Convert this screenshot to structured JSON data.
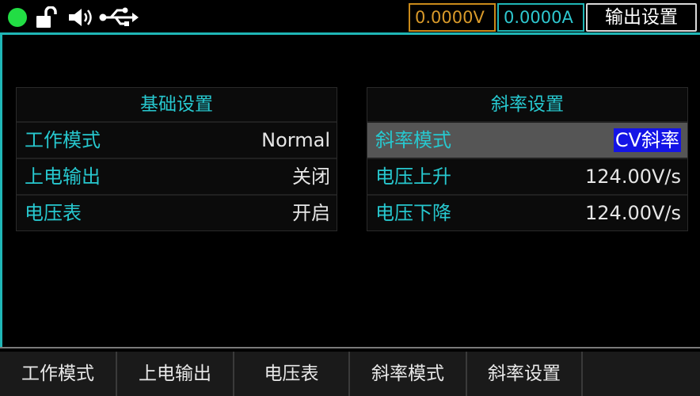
{
  "status": {
    "indicator_color": "#22dd44",
    "icons": [
      "lock-open-icon",
      "speaker-icon",
      "usb-icon"
    ],
    "voltage_readout": "0.0000V",
    "current_readout": "0.0000A",
    "page_title": "输出设置"
  },
  "panels": {
    "basic": {
      "title": "基础设置",
      "rows": [
        {
          "label": "工作模式",
          "value": "Normal"
        },
        {
          "label": "上电输出",
          "value": "关闭"
        },
        {
          "label": "电压表",
          "value": "开启"
        }
      ]
    },
    "slope": {
      "title": "斜率设置",
      "rows": [
        {
          "label": "斜率模式",
          "value": "CV斜率"
        },
        {
          "label": "电压上升",
          "value": "124.00V/s"
        },
        {
          "label": "电压下降",
          "value": "124.00V/s"
        }
      ]
    }
  },
  "softkeys": [
    "工作模式",
    "上电输出",
    "电压表",
    "斜率模式",
    "斜率设置"
  ],
  "colors": {
    "accent": "#1fb6b6",
    "label_text": "#27c8cf",
    "voltage": "#d99a2a",
    "selection": "#1414e6"
  }
}
